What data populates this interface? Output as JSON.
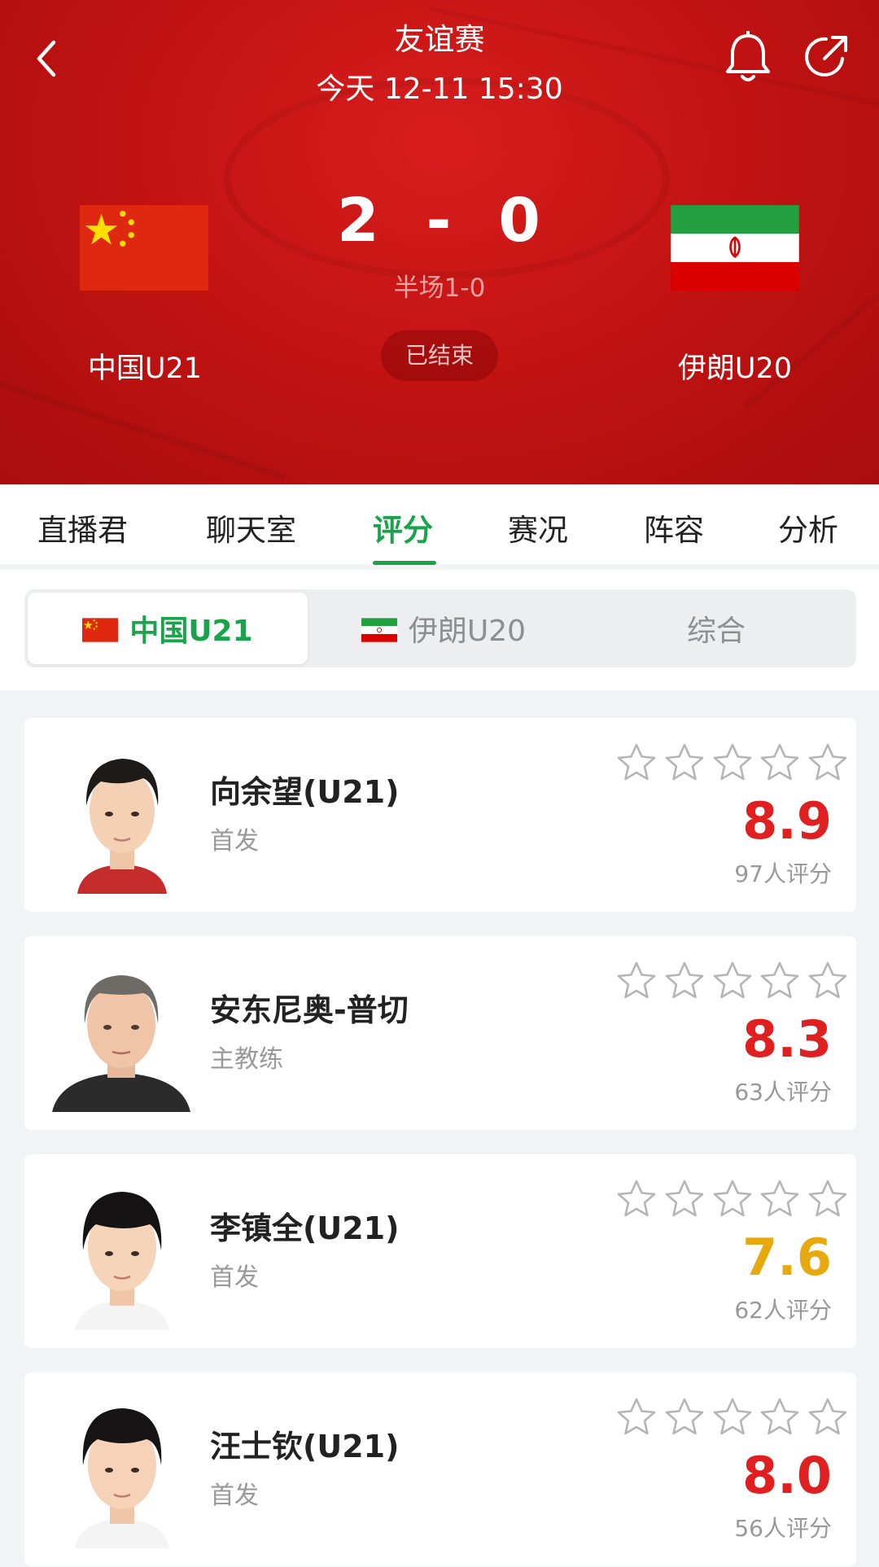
{
  "header": {
    "title": "友谊赛",
    "datetime": "今天 12-11 15:30",
    "home_team": "中国U21",
    "away_team": "伊朗U20",
    "home_score": "2",
    "score_separator": "-",
    "away_score": "0",
    "halftime": "半场1-0",
    "status": "已结束"
  },
  "tabs": [
    {
      "label": "直播君"
    },
    {
      "label": "聊天室"
    },
    {
      "label": "评分",
      "active": true
    },
    {
      "label": "赛况"
    },
    {
      "label": "阵容"
    },
    {
      "label": "分析"
    }
  ],
  "segments": [
    {
      "label": "中国U21",
      "active": true
    },
    {
      "label": "伊朗U20"
    },
    {
      "label": "综合"
    }
  ],
  "players": [
    {
      "name": "向余望(U21)",
      "role": "首发",
      "rating": "8.9",
      "count": "97人评分",
      "rating_color": "#e02020"
    },
    {
      "name": "安东尼奥-普切",
      "role": "主教练",
      "rating": "8.3",
      "count": "63人评分",
      "rating_color": "#e02020"
    },
    {
      "name": "李镇全(U21)",
      "role": "首发",
      "rating": "7.6",
      "count": "62人评分",
      "rating_color": "#e8a90e"
    },
    {
      "name": "汪士钦(U21)",
      "role": "首发",
      "rating": "8.0",
      "count": "56人评分",
      "rating_color": "#e02020"
    }
  ],
  "colors": {
    "header_red": "#c41313",
    "accent_green": "#1aa34a",
    "rating_red": "#e02020",
    "rating_yellow": "#e8a90e"
  },
  "icons": [
    "back-arrow-icon",
    "bell-icon",
    "share-icon",
    "star-outline-icon",
    "china-flag-icon",
    "iran-flag-icon"
  ]
}
